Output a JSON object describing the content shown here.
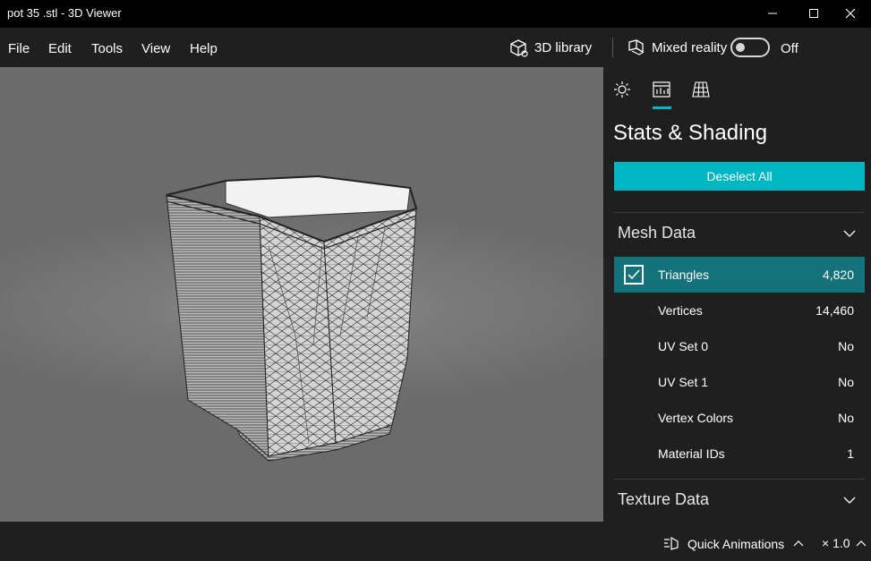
{
  "window": {
    "title": "pot 35 .stl - 3D Viewer"
  },
  "menu": {
    "items": [
      "File",
      "Edit",
      "Tools",
      "View",
      "Help"
    ]
  },
  "toolbar": {
    "library_label": "3D library",
    "mixed_reality_label": "Mixed reality",
    "toggle_state": "Off"
  },
  "panel": {
    "tabs": [
      "lighting-icon",
      "stats-icon",
      "grid-icon"
    ],
    "title": "Stats & Shading",
    "deselect_label": "Deselect All",
    "mesh_section": "Mesh Data",
    "mesh_rows": [
      {
        "label": "Triangles",
        "value": "4,820",
        "checked": true
      },
      {
        "label": "Vertices",
        "value": "14,460"
      },
      {
        "label": "UV Set 0",
        "value": "No"
      },
      {
        "label": "UV Set 1",
        "value": "No"
      },
      {
        "label": "Vertex Colors",
        "value": "No"
      },
      {
        "label": "Material IDs",
        "value": "1"
      }
    ],
    "texture_section": "Texture Data"
  },
  "status": {
    "animations_label": "Quick Animations",
    "speed": "× 1.0"
  },
  "colors": {
    "accent": "#00b7c3",
    "selected_row": "#13727a",
    "background": "#1f1f1f"
  }
}
